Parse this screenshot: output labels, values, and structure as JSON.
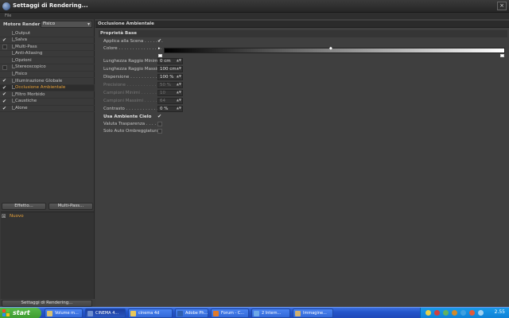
{
  "window": {
    "title": "Settaggi di Rendering...",
    "menu_item": "File",
    "close_glyph": "×"
  },
  "left_panel": {
    "engine_label": "Motore Render",
    "engine_value": "Fisico",
    "tree_items": [
      {
        "label": "Output",
        "checked": false,
        "has_box": false
      },
      {
        "label": "Salva",
        "checked": true,
        "has_box": false
      },
      {
        "label": "Multi-Pass",
        "checked": false,
        "has_box": true
      },
      {
        "label": "Anti-Aliasing",
        "checked": false,
        "has_box": false
      },
      {
        "label": "Opzioni",
        "checked": false,
        "has_box": false
      },
      {
        "label": "Stereoscopico",
        "checked": false,
        "has_box": true
      },
      {
        "label": "Fisico",
        "checked": false,
        "has_box": false
      },
      {
        "label": "Illuminazione Globale",
        "checked": true,
        "has_box": false
      },
      {
        "label": "Occlusione Ambientale",
        "checked": true,
        "has_box": false,
        "selected": true
      },
      {
        "label": "Filtro Morbido",
        "checked": true,
        "has_box": false
      },
      {
        "label": "Caustiche",
        "checked": true,
        "has_box": false
      },
      {
        "label": "Alone",
        "checked": true,
        "has_box": false
      }
    ],
    "effects_button": "Effetto...",
    "multipass_button": "Multi-Pass...",
    "effect_item": {
      "label": "Nuovo",
      "check_glyph": "☒"
    },
    "settings_button": "Settaggi di Rendering..."
  },
  "right_panel": {
    "section_title": "Occlusione Ambientale",
    "group_title": "Proprietà Base",
    "apply_label": "Applica alla Scena . . . . . . .",
    "apply_checked": true,
    "color_label": "Colore . . . . . . . . . . . . . . . . .",
    "min_ray_label": "Lunghezza Raggio Minima",
    "min_ray_value": "0 cm",
    "max_ray_label": "Lunghezza Raggio Massima",
    "max_ray_value": "100 cm",
    "dispersion_label": "Dispersione . . . . . . . . . . . . .",
    "dispersion_value": "100 %",
    "accuracy_label": "Precisione . . . . . . . . . . . . . .",
    "accuracy_value": "50 %",
    "min_samples_label": "Campioni Minimi . . . . . . . .",
    "min_samples_value": "10",
    "max_samples_label": "Campioni Massimi . . . . . . .",
    "max_samples_value": "64",
    "contrast_label": "Contrasto . . . . . . . . . . . . . . .",
    "contrast_value": "0 %",
    "use_sky_label": "Usa Ambiente Cielo",
    "use_sky_checked": true,
    "transparency_label": "Valuta Trasparenza . . . .",
    "self_shadow_label": "Solo Auto Ombreggiatura",
    "check_glyph": "✔",
    "spin_glyph": "▲▼"
  },
  "taskbar": {
    "start_label": "start",
    "buttons": [
      {
        "label": "Volume m...",
        "color": "#d8c070"
      },
      {
        "label": "CINEMA 4...",
        "color": "#6f8fd0",
        "active": true
      },
      {
        "label": "cinema 4d",
        "color": "#e9c75a"
      },
      {
        "label": "Adobe Ph...",
        "color": "#2f5fb0"
      },
      {
        "label": "Forum - C...",
        "color": "#e07a2a"
      },
      {
        "label": "2 Intern...",
        "color": "#6da8e8"
      },
      {
        "label": "Immagine...",
        "color": "#d0b070"
      }
    ],
    "tray_colors": [
      "#e6d24a",
      "#d04040",
      "#5fb25f",
      "#cf8a2a",
      "#3fa0e0",
      "#e25a3a",
      "#a0d0f0"
    ],
    "clock": "2.55"
  },
  "colors": {
    "accent": "#e8a23a",
    "panel": "#3f3f3f",
    "taskbar": "#2454c9",
    "start": "#3c9a30"
  }
}
